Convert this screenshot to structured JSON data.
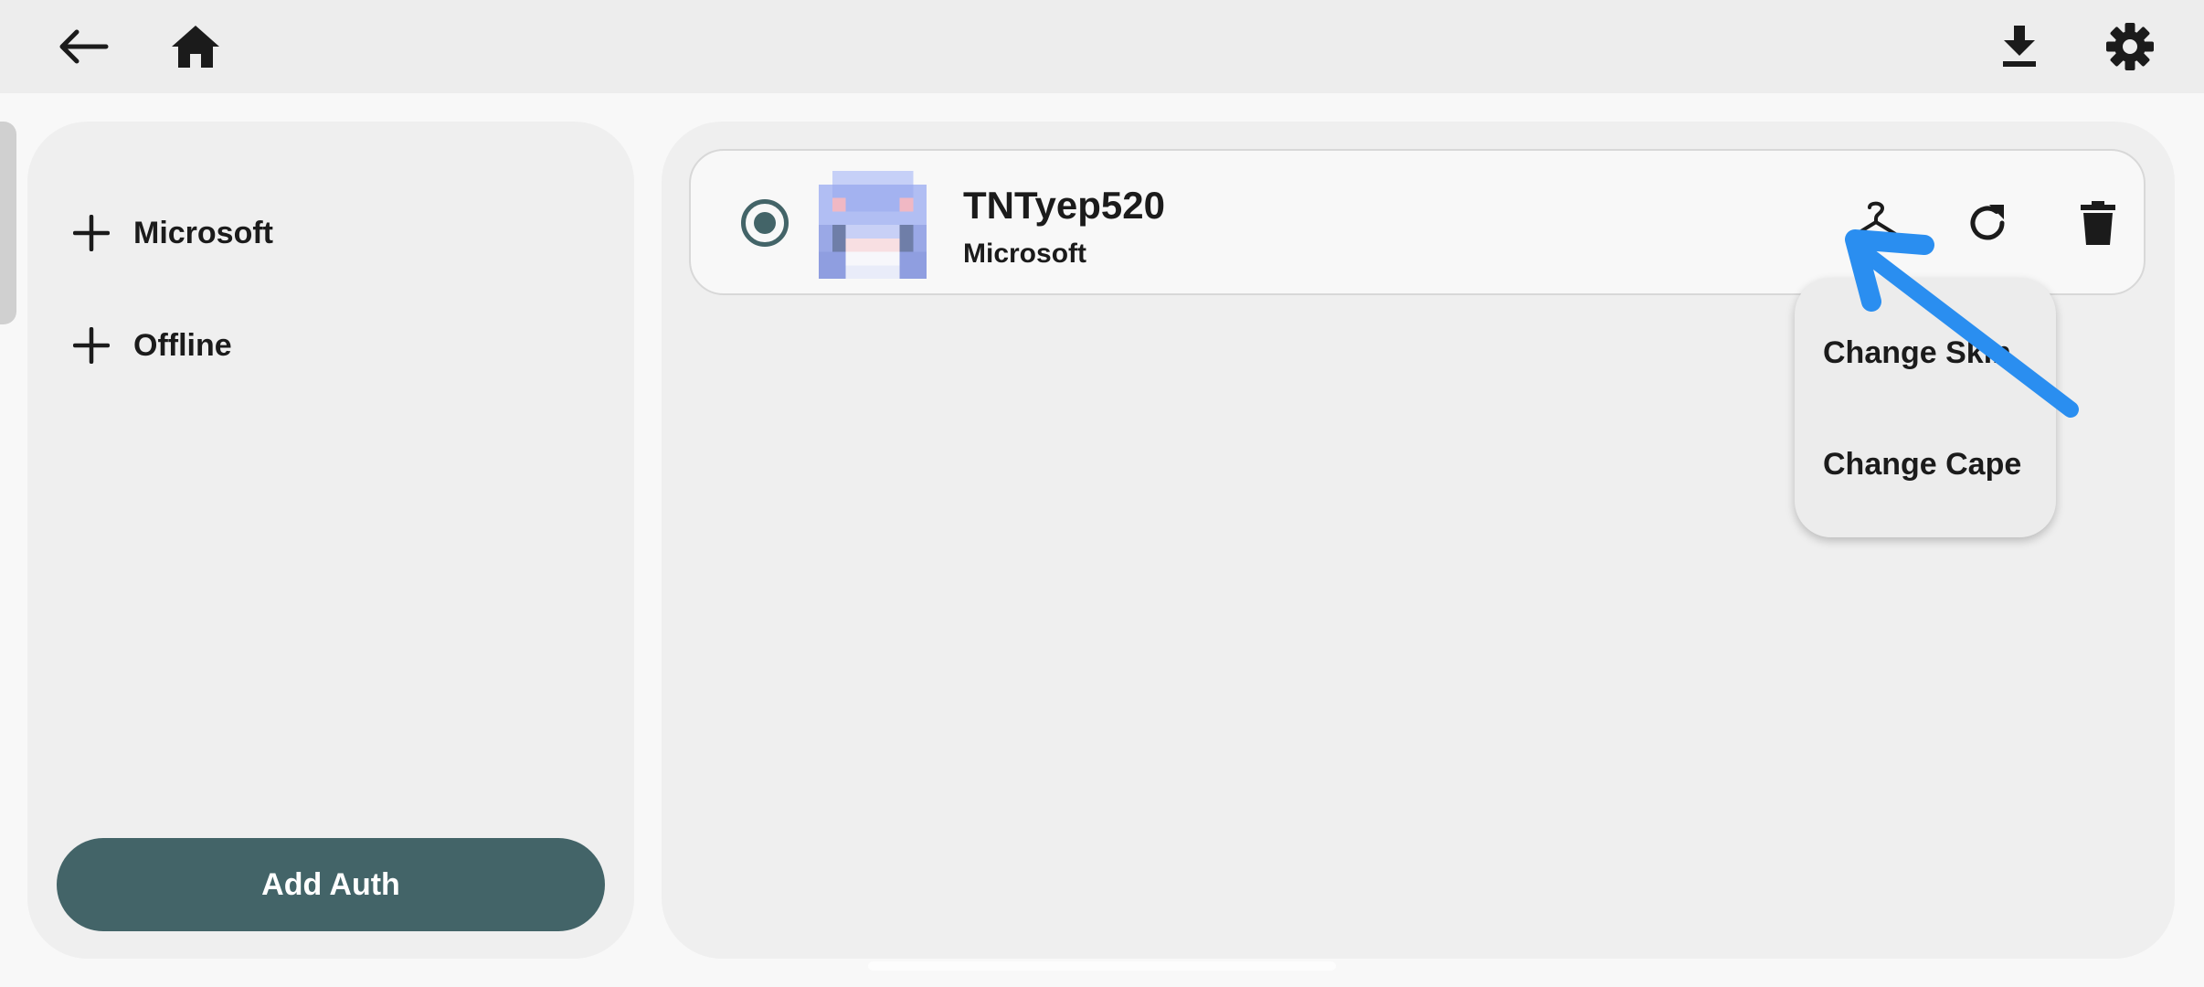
{
  "topbar": {
    "back_icon": "arrow-left-icon",
    "home_icon": "home-icon",
    "download_icon": "download-icon",
    "settings_icon": "gear-icon"
  },
  "sidebar": {
    "items": [
      {
        "label": "Microsoft",
        "icon": "plus-icon"
      },
      {
        "label": "Offline",
        "icon": "plus-icon"
      }
    ],
    "add_auth_label": "Add Auth"
  },
  "account": {
    "name": "TNTyep520",
    "type": "Microsoft",
    "selected": true
  },
  "account_actions": {
    "skin_icon": "hanger-icon",
    "refresh_icon": "refresh-icon",
    "delete_icon": "trash-icon"
  },
  "menu": {
    "items": [
      {
        "label": "Change Skin"
      },
      {
        "label": "Change Cape"
      }
    ]
  },
  "colors": {
    "accent": "#436468",
    "background": "#f8f8f8",
    "panel": "#efefef",
    "annotation_arrow": "#2a8ef0"
  }
}
